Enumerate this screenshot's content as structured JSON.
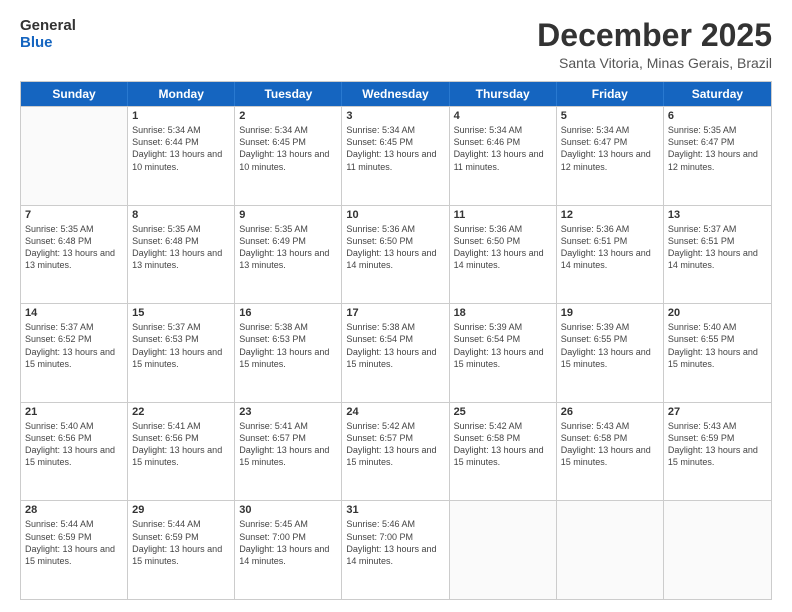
{
  "logo": {
    "line1": "General",
    "line2": "Blue"
  },
  "title": "December 2025",
  "subtitle": "Santa Vitoria, Minas Gerais, Brazil",
  "weekdays": [
    "Sunday",
    "Monday",
    "Tuesday",
    "Wednesday",
    "Thursday",
    "Friday",
    "Saturday"
  ],
  "weeks": [
    [
      {
        "day": "",
        "empty": true
      },
      {
        "day": "1",
        "sunrise": "Sunrise: 5:34 AM",
        "sunset": "Sunset: 6:44 PM",
        "daylight": "Daylight: 13 hours and 10 minutes."
      },
      {
        "day": "2",
        "sunrise": "Sunrise: 5:34 AM",
        "sunset": "Sunset: 6:45 PM",
        "daylight": "Daylight: 13 hours and 10 minutes."
      },
      {
        "day": "3",
        "sunrise": "Sunrise: 5:34 AM",
        "sunset": "Sunset: 6:45 PM",
        "daylight": "Daylight: 13 hours and 11 minutes."
      },
      {
        "day": "4",
        "sunrise": "Sunrise: 5:34 AM",
        "sunset": "Sunset: 6:46 PM",
        "daylight": "Daylight: 13 hours and 11 minutes."
      },
      {
        "day": "5",
        "sunrise": "Sunrise: 5:34 AM",
        "sunset": "Sunset: 6:47 PM",
        "daylight": "Daylight: 13 hours and 12 minutes."
      },
      {
        "day": "6",
        "sunrise": "Sunrise: 5:35 AM",
        "sunset": "Sunset: 6:47 PM",
        "daylight": "Daylight: 13 hours and 12 minutes."
      }
    ],
    [
      {
        "day": "7",
        "sunrise": "Sunrise: 5:35 AM",
        "sunset": "Sunset: 6:48 PM",
        "daylight": "Daylight: 13 hours and 13 minutes."
      },
      {
        "day": "8",
        "sunrise": "Sunrise: 5:35 AM",
        "sunset": "Sunset: 6:48 PM",
        "daylight": "Daylight: 13 hours and 13 minutes."
      },
      {
        "day": "9",
        "sunrise": "Sunrise: 5:35 AM",
        "sunset": "Sunset: 6:49 PM",
        "daylight": "Daylight: 13 hours and 13 minutes."
      },
      {
        "day": "10",
        "sunrise": "Sunrise: 5:36 AM",
        "sunset": "Sunset: 6:50 PM",
        "daylight": "Daylight: 13 hours and 14 minutes."
      },
      {
        "day": "11",
        "sunrise": "Sunrise: 5:36 AM",
        "sunset": "Sunset: 6:50 PM",
        "daylight": "Daylight: 13 hours and 14 minutes."
      },
      {
        "day": "12",
        "sunrise": "Sunrise: 5:36 AM",
        "sunset": "Sunset: 6:51 PM",
        "daylight": "Daylight: 13 hours and 14 minutes."
      },
      {
        "day": "13",
        "sunrise": "Sunrise: 5:37 AM",
        "sunset": "Sunset: 6:51 PM",
        "daylight": "Daylight: 13 hours and 14 minutes."
      }
    ],
    [
      {
        "day": "14",
        "sunrise": "Sunrise: 5:37 AM",
        "sunset": "Sunset: 6:52 PM",
        "daylight": "Daylight: 13 hours and 15 minutes."
      },
      {
        "day": "15",
        "sunrise": "Sunrise: 5:37 AM",
        "sunset": "Sunset: 6:53 PM",
        "daylight": "Daylight: 13 hours and 15 minutes."
      },
      {
        "day": "16",
        "sunrise": "Sunrise: 5:38 AM",
        "sunset": "Sunset: 6:53 PM",
        "daylight": "Daylight: 13 hours and 15 minutes."
      },
      {
        "day": "17",
        "sunrise": "Sunrise: 5:38 AM",
        "sunset": "Sunset: 6:54 PM",
        "daylight": "Daylight: 13 hours and 15 minutes."
      },
      {
        "day": "18",
        "sunrise": "Sunrise: 5:39 AM",
        "sunset": "Sunset: 6:54 PM",
        "daylight": "Daylight: 13 hours and 15 minutes."
      },
      {
        "day": "19",
        "sunrise": "Sunrise: 5:39 AM",
        "sunset": "Sunset: 6:55 PM",
        "daylight": "Daylight: 13 hours and 15 minutes."
      },
      {
        "day": "20",
        "sunrise": "Sunrise: 5:40 AM",
        "sunset": "Sunset: 6:55 PM",
        "daylight": "Daylight: 13 hours and 15 minutes."
      }
    ],
    [
      {
        "day": "21",
        "sunrise": "Sunrise: 5:40 AM",
        "sunset": "Sunset: 6:56 PM",
        "daylight": "Daylight: 13 hours and 15 minutes."
      },
      {
        "day": "22",
        "sunrise": "Sunrise: 5:41 AM",
        "sunset": "Sunset: 6:56 PM",
        "daylight": "Daylight: 13 hours and 15 minutes."
      },
      {
        "day": "23",
        "sunrise": "Sunrise: 5:41 AM",
        "sunset": "Sunset: 6:57 PM",
        "daylight": "Daylight: 13 hours and 15 minutes."
      },
      {
        "day": "24",
        "sunrise": "Sunrise: 5:42 AM",
        "sunset": "Sunset: 6:57 PM",
        "daylight": "Daylight: 13 hours and 15 minutes."
      },
      {
        "day": "25",
        "sunrise": "Sunrise: 5:42 AM",
        "sunset": "Sunset: 6:58 PM",
        "daylight": "Daylight: 13 hours and 15 minutes."
      },
      {
        "day": "26",
        "sunrise": "Sunrise: 5:43 AM",
        "sunset": "Sunset: 6:58 PM",
        "daylight": "Daylight: 13 hours and 15 minutes."
      },
      {
        "day": "27",
        "sunrise": "Sunrise: 5:43 AM",
        "sunset": "Sunset: 6:59 PM",
        "daylight": "Daylight: 13 hours and 15 minutes."
      }
    ],
    [
      {
        "day": "28",
        "sunrise": "Sunrise: 5:44 AM",
        "sunset": "Sunset: 6:59 PM",
        "daylight": "Daylight: 13 hours and 15 minutes."
      },
      {
        "day": "29",
        "sunrise": "Sunrise: 5:44 AM",
        "sunset": "Sunset: 6:59 PM",
        "daylight": "Daylight: 13 hours and 15 minutes."
      },
      {
        "day": "30",
        "sunrise": "Sunrise: 5:45 AM",
        "sunset": "Sunset: 7:00 PM",
        "daylight": "Daylight: 13 hours and 14 minutes."
      },
      {
        "day": "31",
        "sunrise": "Sunrise: 5:46 AM",
        "sunset": "Sunset: 7:00 PM",
        "daylight": "Daylight: 13 hours and 14 minutes."
      },
      {
        "day": "",
        "empty": true
      },
      {
        "day": "",
        "empty": true
      },
      {
        "day": "",
        "empty": true
      }
    ]
  ]
}
